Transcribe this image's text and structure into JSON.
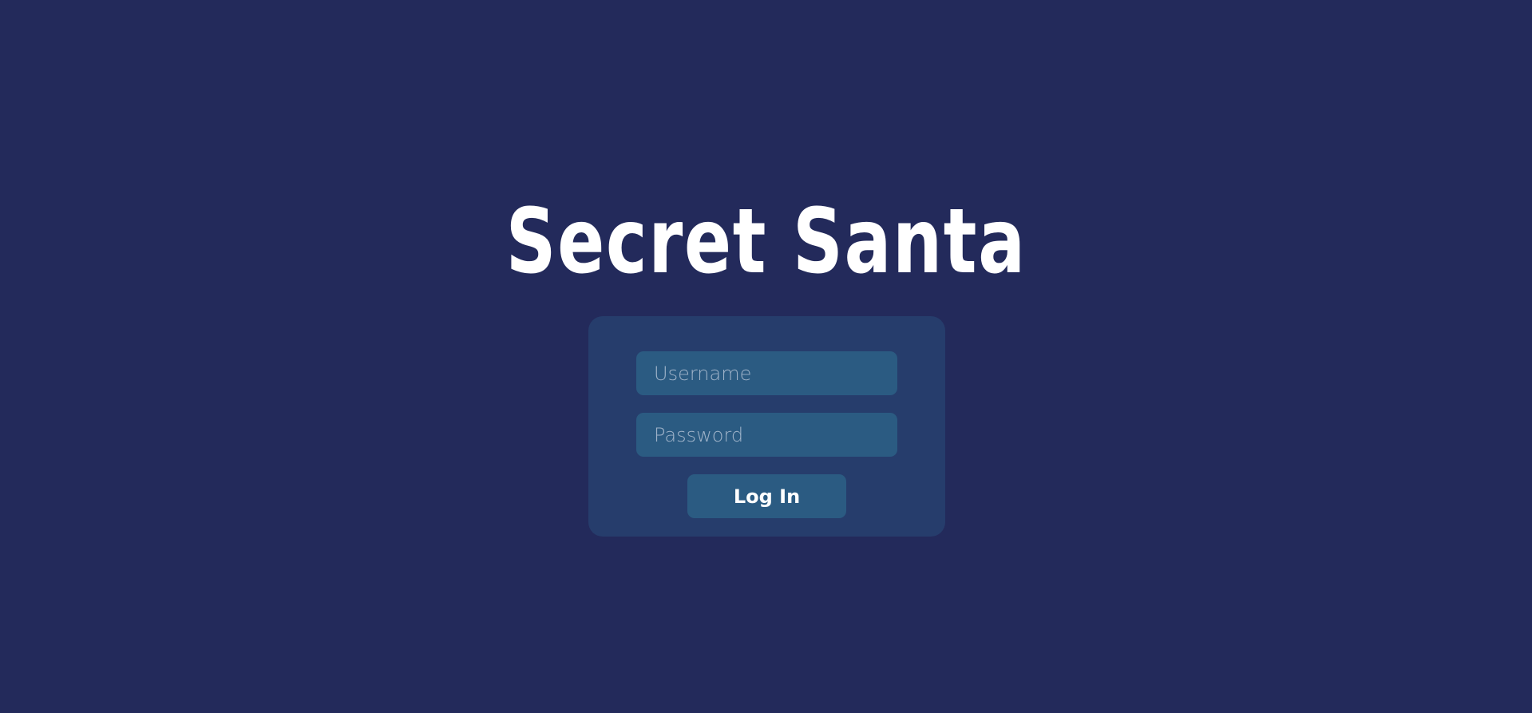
{
  "app": {
    "title": "Secret Santa"
  },
  "login_form": {
    "username_placeholder": "Username",
    "password_placeholder": "Password",
    "submit_label": "Log In"
  },
  "colors": {
    "background": "#232a5b",
    "card": "#263d6c",
    "field": "#2b5b82",
    "text": "#ffffff",
    "placeholder": "#9fb3c9"
  }
}
